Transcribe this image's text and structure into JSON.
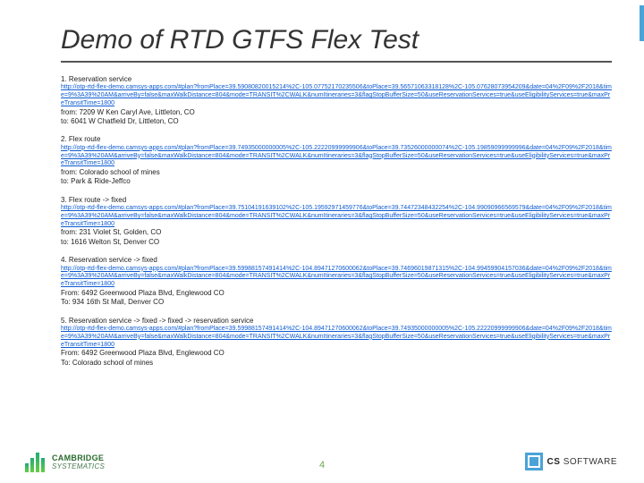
{
  "title": "Demo of RTD GTFS Flex Test",
  "page_number": "4",
  "sections": [
    {
      "label": "1. Reservation service",
      "url": "http://otp-rtd-flex-demo.camsys-apps.com/#plan?fromPlace=39.59080820015214%2C-105.07752170235506&toPlace=39.56571063318128%2C-105.07628073954209&date=04%2F09%2F2018&time=9%3A39%20AM&arriveBy=false&maxWalkDistance=804&mode=TRANSIT%2CWALK&numItineraries=3&flagStopBufferSize=50&useReservationServices=true&useEligibilityServices=true&maxPreTransitTime=1800",
      "from": "from: 7209 W Ken Caryl Ave, Littleton, CO",
      "to": "to: 6041 W Chatfield Dr, Littleton, CO"
    },
    {
      "label": "2. Flex route",
      "url": "http://otp-rtd-flex-demo.camsys-apps.com/#plan?fromPlace=39.74935000000005%2C-105.22220999999906&toPlace=39.73526000000074%2C-105.19859099999996&date=04%2F09%2F2018&time=9%3A39%20AM&arriveBy=false&maxWalkDistance=804&mode=TRANSIT%2CWALK&numItineraries=3&flagStopBufferSize=50&useReservationServices=true&useEligibilityServices=true&maxPreTransitTime=1800",
      "from": "from: Colorado school of mines",
      "to": "to: Park & Ride-Jeffco"
    },
    {
      "label": "3. Flex route -> fixed",
      "url": "http://otp-rtd-flex-demo.camsys-apps.com/#plan?fromPlace=39.75104191639102%2C-105.19592971459776&toPlace=39.74472348432254%2C-104.99090966569579&date=04%2F09%2F2018&time=9%3A39%20AM&arriveBy=false&maxWalkDistance=804&mode=TRANSIT%2CWALK&numItineraries=3&flagStopBufferSize=50&useReservationServices=true&useEligibilityServices=true&maxPreTransitTime=1800",
      "from": "from: 231 Violet St, Golden, CO",
      "to": "to: 1616 Welton St, Denver CO"
    },
    {
      "label": "4. Reservation service -> fixed",
      "url": "http://otp-rtd-flex-demo.camsys-apps.com/#plan?fromPlace=39.59988157491414%2C-104.89471270600062&toPlace=39.74696019871315%2C-104.99459904157036&date=04%2F09%2F2018&time=9%3A39%20AM&arriveBy=false&maxWalkDistance=804&mode=TRANSIT%2CWALK&numItineraries=3&flagStopBufferSize=50&useReservationServices=true&useEligibilityServices=true&maxPreTransitTime=1800",
      "from": "From: 6492 Greenwood Plaza Blvd, Englewood CO",
      "to": "To: 934 16th St Mall, Denver CO"
    },
    {
      "label": "5. Reservation service -> fixed -> fixed -> reservation service",
      "url": "http://otp-rtd-flex-demo.camsys-apps.com/#plan?fromPlace=39.59988157491414%2C-104.89471270600062&toPlace=39.74935000000005%2C-105.22220999999906&date=04%2F09%2F2018&time=9%3A39%20AM&arriveBy=false&maxWalkDistance=804&mode=TRANSIT%2CWALK&numItineraries=3&flagStopBufferSize=50&useReservationServices=true&useEligibilityServices=true&maxPreTransitTime=1800",
      "from": "From: 6492 Greenwood Plaza Blvd, Englewood CO",
      "to": "To: Colorado school of mines"
    }
  ],
  "logo_left": {
    "line1": "CAMBRIDGE",
    "line2": "SYSTEMATICS"
  },
  "logo_right": {
    "brand": "CS",
    "word": "SOFTWARE"
  }
}
